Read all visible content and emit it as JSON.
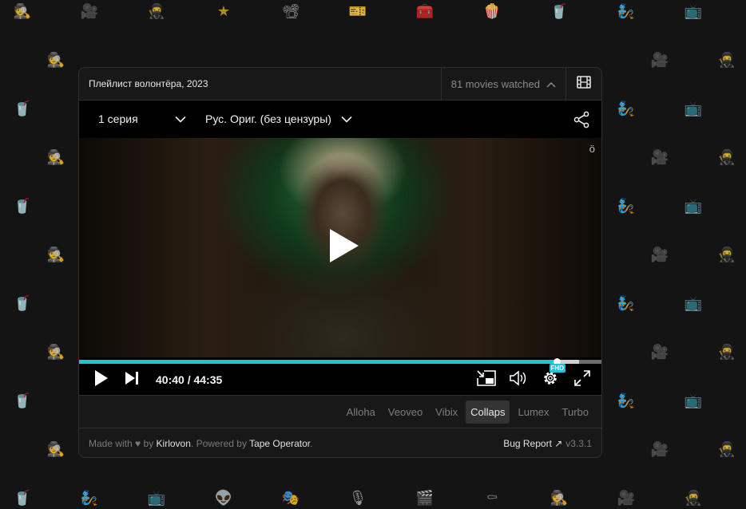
{
  "colors": {
    "accent": "#1fc3d8",
    "page_background": "#141414",
    "panel_background": "#181818"
  },
  "background_icons": [
    "detective-icon",
    "popcorn-icon",
    "clapperboard-icon",
    "ticket-icon",
    "theater-masks-icon",
    "star-icon",
    "tv-icon",
    "movie-camera-icon",
    "soda-cup-icon",
    "coffin-icon",
    "treasure-chest-icon",
    "microphone-icon",
    "projector-icon",
    "alien-icon",
    "ninja-icon",
    "genie-icon"
  ],
  "header": {
    "playlist_title": "Плейлист волонтёра, 2023",
    "watched_label": "81 movies watched",
    "film_icon": "film-strip-icon"
  },
  "player": {
    "episode_select": "1 серия",
    "audio_select": "Рус. Ориг. (без цензуры)",
    "watermark": "ö",
    "current_time": "40:40",
    "time_separator": " / ",
    "duration": "44:35",
    "progress_fraction": 0.912,
    "buffered_fraction": 0.955,
    "quality_badge": "FHD"
  },
  "sources": [
    {
      "label": "Alloha",
      "active": false
    },
    {
      "label": "Veoveo",
      "active": false
    },
    {
      "label": "Vibix",
      "active": false
    },
    {
      "label": "Collaps",
      "active": true
    },
    {
      "label": "Lumex",
      "active": false
    },
    {
      "label": "Turbo",
      "active": false
    }
  ],
  "footer": {
    "made_with": "Made with",
    "heart": "♥",
    "by": "by",
    "author": "Kirlovon",
    "powered_by": ". Powered by",
    "powered_name": "Tape Operator",
    "bug_report": "Bug Report ↗",
    "version": "v3.3.1"
  }
}
